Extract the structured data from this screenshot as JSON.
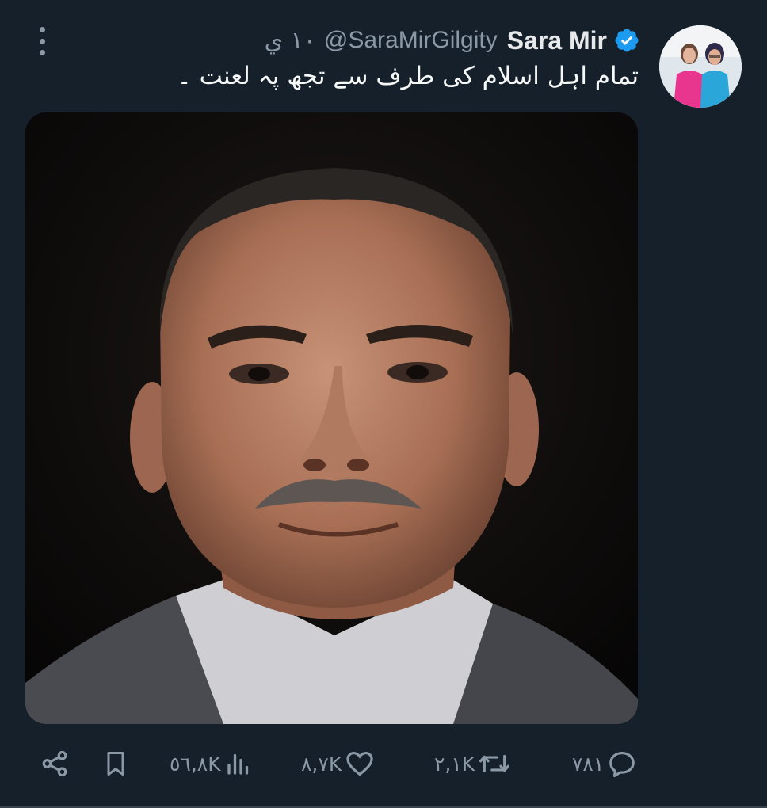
{
  "tweet": {
    "display_name": "Sara Mir",
    "handle": "@SaraMirGilgity",
    "time": "١٠ ي",
    "text": "تمام اہل اسلام کی طرف سے تجھ پہ لعنت ۔",
    "verified": true
  },
  "actions": {
    "replies": "٧٨١",
    "retweets": "٢,١K",
    "likes": "٨,٧K",
    "views": "٥٦,٨K"
  },
  "icons": {
    "more": "more-vertical-icon",
    "verified": "verified-badge-icon",
    "reply": "reply-icon",
    "retweet": "retweet-icon",
    "like": "heart-icon",
    "views": "views-icon",
    "bookmark": "bookmark-icon",
    "share": "share-icon"
  },
  "colors": {
    "background": "#15202b",
    "verified": "#1d9bf0",
    "muted": "#8b98a5",
    "text": "#e7e9ea"
  }
}
